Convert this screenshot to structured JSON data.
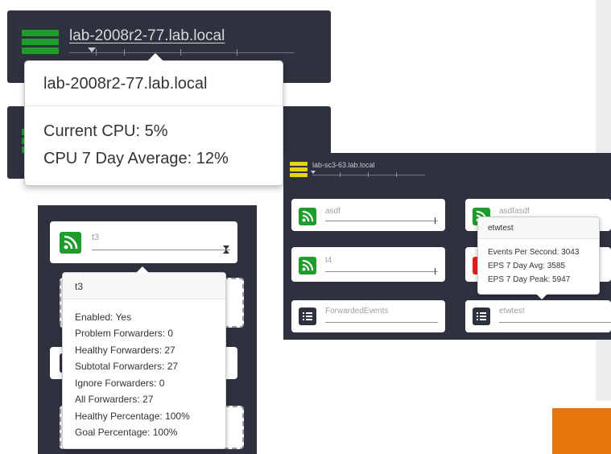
{
  "host_panel": {
    "hostname": "lab-2008r2-77.lab.local",
    "status_color": "#1f9d2c"
  },
  "cpu_popup": {
    "title": "lab-2008r2-77.lab.local",
    "current_cpu": "Current CPU: 5%",
    "avg_cpu": "CPU 7 Day Average: 12%"
  },
  "forwarder_panel": {
    "card_label": "t3",
    "popup": {
      "title": "t3",
      "lines": [
        "Enabled: Yes",
        "Problem Forwarders: 0",
        "Healthy Forwarders: 27",
        "Subtotal Forwarders: 27",
        "Ignore Forwarders: 0",
        "All Forwarders: 27",
        "Healthy Percentage: 100%",
        "Goal Percentage: 100%"
      ]
    }
  },
  "collector_panel": {
    "hostname": "lab-sc3-63.lab.local",
    "status_color": "#e5d31a",
    "cards": [
      {
        "label": "asdf",
        "icon": "rss-icon",
        "color": "#1f9d2c"
      },
      {
        "label": "asdfasdf",
        "icon": "rss-icon",
        "color": "#1f9d2c"
      },
      {
        "label": "t4",
        "icon": "rss-icon",
        "color": "#1f9d2c"
      },
      {
        "label": "",
        "icon": "rss-icon",
        "color": "#e42222"
      },
      {
        "label": "ForwardedEvents",
        "icon": "list-icon",
        "color": "#2e323f"
      },
      {
        "label": "etwtest",
        "icon": "list-icon",
        "color": "#2e323f"
      }
    ],
    "popup": {
      "title": "etwtest",
      "lines": [
        "Events Per Second: 3043",
        "EPS 7 Day Avg: 3585",
        "EPS 7 Day Peak: 5947"
      ]
    }
  },
  "colors": {
    "dark_bg": "#2e323f",
    "accent_orange": "#e8740c"
  }
}
